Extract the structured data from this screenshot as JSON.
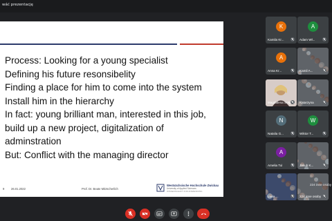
{
  "topbar": {
    "title": "wáć prezentację"
  },
  "slide": {
    "lines": [
      "Process: Looking for a young specialist",
      "Defining his future resonsibelity",
      "Finding a place for him to come into the system",
      "Install him in the hierarchy",
      "In fact: young brilliant man, interested in this job,",
      "build up a new project, digitalization of",
      "adminstration",
      "But: Conflict with the managing director"
    ],
    "footer": {
      "page": "9",
      "date": "26.01.2022",
      "presenter": "Prof. Dr. Beate Mitzscherlich",
      "university": "Westsächsische Hochschule Zwickau",
      "university_sub": "University of Applied Sciences",
      "university_tag": "WISSENSCHAFT FÜR ANWENDUNG"
    }
  },
  "participants": [
    {
      "initial": "K",
      "name": "Kamila Kr...",
      "color": "#e8710a",
      "type": "avatar"
    },
    {
      "initial": "A",
      "name": "Adam Wł...",
      "color": "#1e8e3e",
      "type": "avatar"
    },
    {
      "initial": "A",
      "name": "Anna Kr...",
      "color": "#e8710a",
      "type": "avatar"
    },
    {
      "initial": "",
      "name": "Kamil A...",
      "color": "#5f6368",
      "type": "photo"
    },
    {
      "initial": "",
      "name": "Magdalena Sołgała",
      "color": "#8d6e63",
      "type": "photo"
    },
    {
      "initial": "",
      "name": "Katarzyna",
      "color": "#5f6368",
      "type": "photo"
    },
    {
      "initial": "N",
      "name": "Natalia G...",
      "color": "#546e7a",
      "type": "avatar"
    },
    {
      "initial": "W",
      "name": "Wiktor T...",
      "color": "#1e8e3e",
      "type": "avatar"
    },
    {
      "initial": "A",
      "name": "Amelia Tul",
      "color": "#7b1fa2",
      "type": "avatar"
    },
    {
      "initial": "",
      "name": "Jakub K...",
      "color": "#5f6368",
      "type": "photo"
    },
    {
      "initial": "",
      "name": "Liwia ...",
      "color": "#3c4a6b",
      "type": "photo"
    },
    {
      "initial": "",
      "name": "224 inne osoby",
      "color": "#5f6368",
      "type": "photo"
    }
  ],
  "participant_count": "224 inne osoby",
  "controls": [
    {
      "icon": "mic-off-icon",
      "color": "#d93025"
    },
    {
      "icon": "camera-off-icon",
      "color": "#d93025"
    },
    {
      "icon": "captions-icon",
      "color": "#3c4043"
    },
    {
      "icon": "present-icon",
      "color": "#3c4043"
    },
    {
      "icon": "more-icon",
      "color": "#3c4043"
    },
    {
      "icon": "end-call-icon",
      "color": "#d93025"
    }
  ]
}
